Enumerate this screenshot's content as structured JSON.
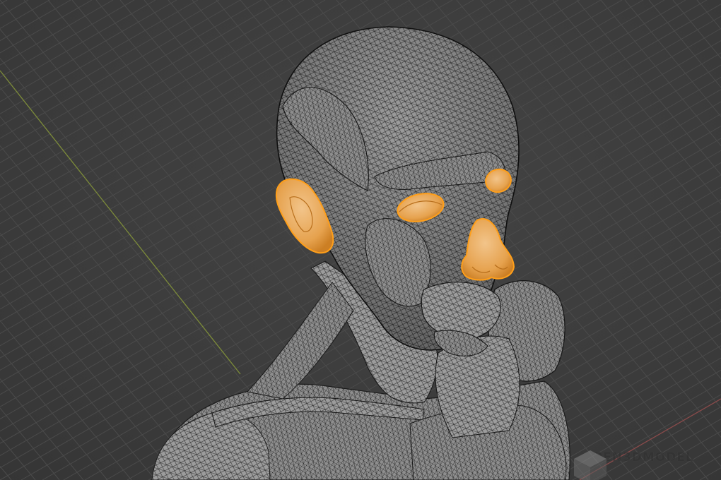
{
  "viewport": {
    "watermark": {
      "text": "OPEN3DMODEL",
      "icon": "cube-icon"
    },
    "colors": {
      "background": "#3c3c3c",
      "grid": "#4a4a4a",
      "axis_x": "#8a4b4b",
      "axis_y": "#7d8c3a",
      "mesh_fill": "#9a9a9a",
      "mesh_wire": "#1e1e1e",
      "selected_fill": "#e7a44c",
      "selected_outline": "#ff9f1a"
    },
    "model": {
      "subject": "ecorche-head-and-shoulders",
      "selected_parts": [
        "left-ear",
        "nose",
        "left-eye",
        "right-eye"
      ]
    }
  }
}
